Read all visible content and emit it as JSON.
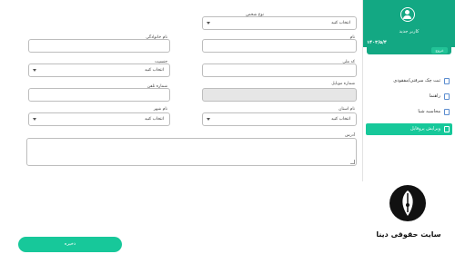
{
  "form": {
    "person_type": {
      "label": "نوع شخص",
      "value": "انتخاب کنید"
    },
    "first_name": {
      "label": "نام",
      "value": ""
    },
    "last_name": {
      "label": "نام خانوادگی",
      "value": ""
    },
    "national_code": {
      "label": "کد ملی",
      "value": ""
    },
    "gender": {
      "label": "جنسیت",
      "value": "انتخاب کنید"
    },
    "mobile": {
      "label": "شماره موبایل",
      "value": ""
    },
    "phone": {
      "label": "شماره تلفن",
      "value": ""
    },
    "province": {
      "label": "نام استان",
      "value": "انتخاب کنید"
    },
    "city": {
      "label": "نام شهر",
      "value": "انتخاب کنید"
    },
    "address": {
      "label": "آدرس",
      "value": ""
    },
    "save_label": "ذخیره"
  },
  "sidebar": {
    "user_name": "کاربر جدید",
    "date": "۱۴۰۳/۵/۴",
    "exit_label": "خروج",
    "menu": [
      {
        "label": "ثبت چک سرقتی/مفقودی",
        "active": false
      },
      {
        "label": "راهنما",
        "active": false
      },
      {
        "label": "محاسبه شبا",
        "active": false
      },
      {
        "label": "ویرایش پروفایل",
        "active": true
      }
    ]
  },
  "brand": {
    "logo_text": "سایت حقوقی دینا"
  },
  "colors": {
    "primary": "#13a883",
    "accent": "#17c89a"
  }
}
